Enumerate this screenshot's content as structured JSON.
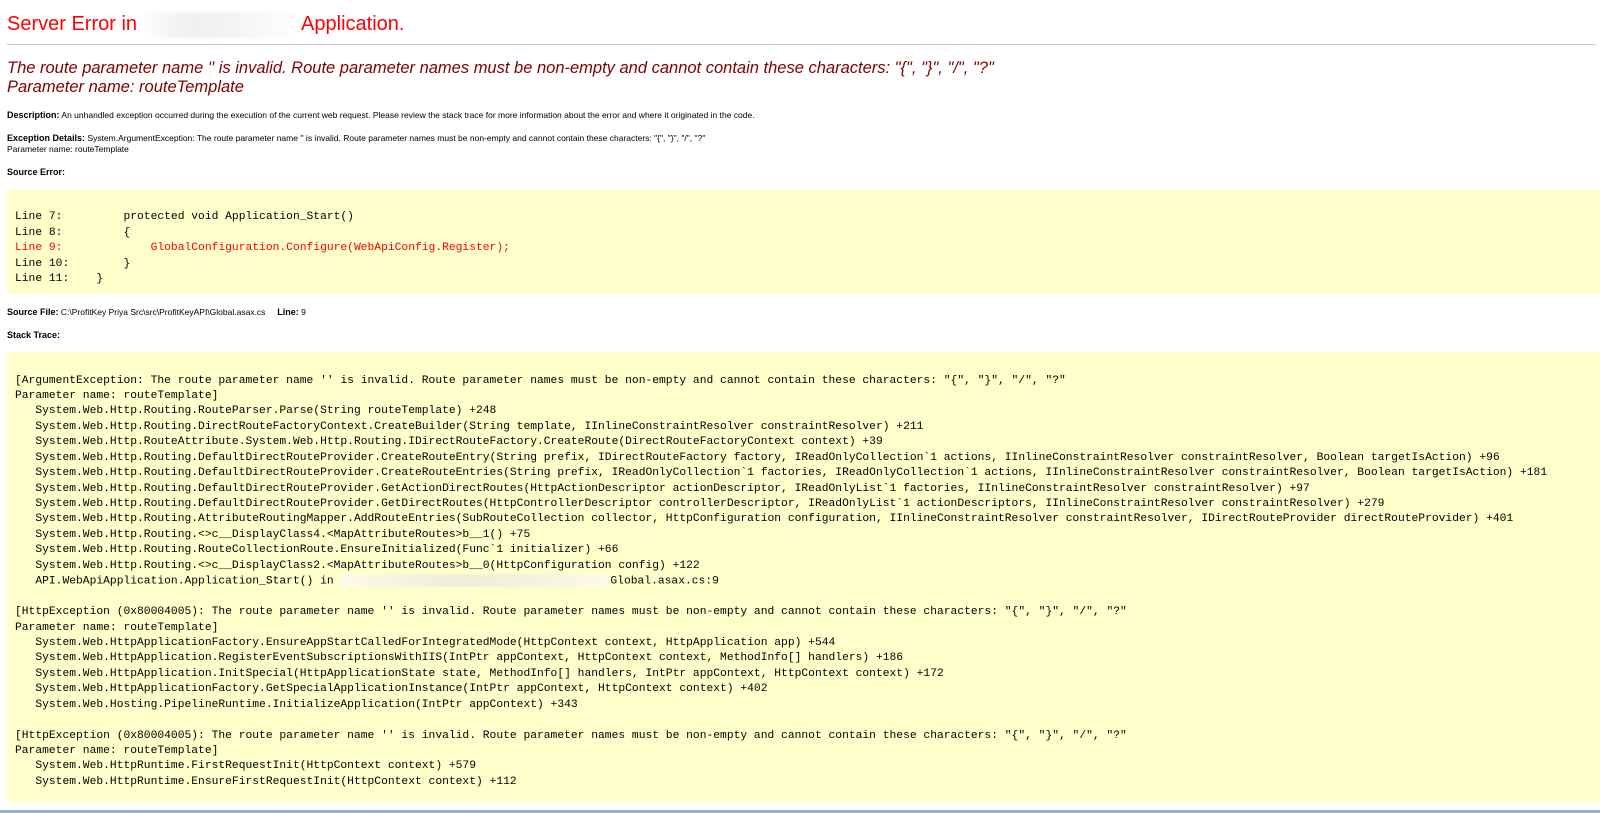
{
  "header": {
    "title_prefix": "Server Error in",
    "title_suffix": "Application."
  },
  "error_message": {
    "line1": "The route parameter name '' is invalid. Route parameter names must be non-empty and cannot contain these characters: \"{\", \"}\", \"/\", \"?\"",
    "line2": "Parameter name: routeTemplate"
  },
  "description": {
    "label": "Description:",
    "text": "An unhandled exception occurred during the execution of the current web request. Please review the stack trace for more information about the error and where it originated in the code."
  },
  "exception_details": {
    "label": "Exception Details:",
    "text": "System.ArgumentException: The route parameter name '' is invalid. Route parameter names must be non-empty and cannot contain these characters: \"{\", \"}\", \"/\", \"?\"",
    "param": "Parameter name: routeTemplate"
  },
  "source_error": {
    "label": "Source Error:",
    "lines": [
      {
        "num": "Line 7: ",
        "code": "        protected void Application_Start()",
        "highlight": false
      },
      {
        "num": "Line 8: ",
        "code": "        {",
        "highlight": false
      },
      {
        "num": "Line 9: ",
        "code": "            GlobalConfiguration.Configure(WebApiConfig.Register);",
        "highlight": true
      },
      {
        "num": "Line 10:",
        "code": "        }",
        "highlight": false
      },
      {
        "num": "Line 11:",
        "code": "    }",
        "highlight": false
      }
    ]
  },
  "source_file": {
    "label": "Source File:",
    "path": "C:\\ProfitKey Priya Src\\src\\ProfitKeyAPI\\Global.asax.cs",
    "line_label": "Line:",
    "line_value": "9"
  },
  "stack_trace": {
    "label": "Stack Trace:",
    "lines": [
      "[ArgumentException: The route parameter name '' is invalid. Route parameter names must be non-empty and cannot contain these characters: \"{\", \"}\", \"/\", \"?\"",
      "Parameter name: routeTemplate]",
      "   System.Web.Http.Routing.RouteParser.Parse(String routeTemplate) +248",
      "   System.Web.Http.Routing.DirectRouteFactoryContext.CreateBuilder(String template, IInlineConstraintResolver constraintResolver) +211",
      "   System.Web.Http.RouteAttribute.System.Web.Http.Routing.IDirectRouteFactory.CreateRoute(DirectRouteFactoryContext context) +39",
      "   System.Web.Http.Routing.DefaultDirectRouteProvider.CreateRouteEntry(String prefix, IDirectRouteFactory factory, IReadOnlyCollection`1 actions, IInlineConstraintResolver constraintResolver, Boolean targetIsAction) +96",
      "   System.Web.Http.Routing.DefaultDirectRouteProvider.CreateRouteEntries(String prefix, IReadOnlyCollection`1 factories, IReadOnlyCollection`1 actions, IInlineConstraintResolver constraintResolver, Boolean targetIsAction) +181",
      "   System.Web.Http.Routing.DefaultDirectRouteProvider.GetActionDirectRoutes(HttpActionDescriptor actionDescriptor, IReadOnlyList`1 factories, IInlineConstraintResolver constraintResolver) +97",
      "   System.Web.Http.Routing.DefaultDirectRouteProvider.GetDirectRoutes(HttpControllerDescriptor controllerDescriptor, IReadOnlyList`1 actionDescriptors, IInlineConstraintResolver constraintResolver) +279",
      "   System.Web.Http.Routing.AttributeRoutingMapper.AddRouteEntries(SubRouteCollection collector, HttpConfiguration configuration, IInlineConstraintResolver constraintResolver, IDirectRouteProvider directRouteProvider) +401",
      "   System.Web.Http.Routing.<>c__DisplayClass4.<MapAttributeRoutes>b__1() +75",
      "   System.Web.Http.Routing.RouteCollectionRoute.EnsureInitialized(Func`1 initializer) +66",
      "   System.Web.Http.Routing.<>c__DisplayClass2.<MapAttributeRoutes>b__0(HttpConfiguration config) +122",
      "   API.WebApiApplication.Application_Start() in |BLUR|Global.asax.cs:9",
      "",
      "[HttpException (0x80004005): The route parameter name '' is invalid. Route parameter names must be non-empty and cannot contain these characters: \"{\", \"}\", \"/\", \"?\"",
      "Parameter name: routeTemplate]",
      "   System.Web.HttpApplicationFactory.EnsureAppStartCalledForIntegratedMode(HttpContext context, HttpApplication app) +544",
      "   System.Web.HttpApplication.RegisterEventSubscriptionsWithIIS(IntPtr appContext, HttpContext context, MethodInfo[] handlers) +186",
      "   System.Web.HttpApplication.InitSpecial(HttpApplicationState state, MethodInfo[] handlers, IntPtr appContext, HttpContext context) +172",
      "   System.Web.HttpApplicationFactory.GetSpecialApplicationInstance(IntPtr appContext, HttpContext context) +402",
      "   System.Web.Hosting.PipelineRuntime.InitializeApplication(IntPtr appContext) +343",
      "",
      "[HttpException (0x80004005): The route parameter name '' is invalid. Route parameter names must be non-empty and cannot contain these characters: \"{\", \"}\", \"/\", \"?\"",
      "Parameter name: routeTemplate]",
      "   System.Web.HttpRuntime.FirstRequestInit(HttpContext context) +579",
      "   System.Web.HttpRuntime.EnsureFirstRequestInit(HttpContext context) +112"
    ]
  },
  "colors": {
    "title": "#ff0000",
    "message": "#800000",
    "code_background": "#ffffcc",
    "highlight_line": "#ff0000"
  }
}
